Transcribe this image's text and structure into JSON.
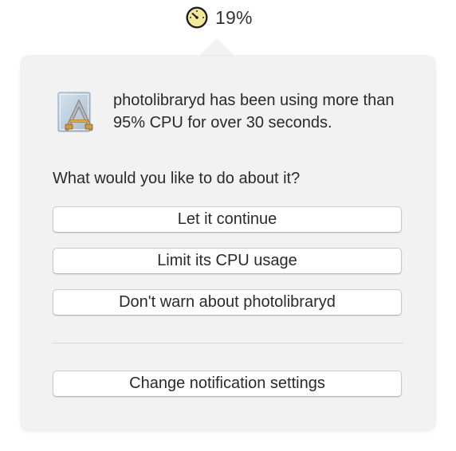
{
  "menubar": {
    "icon": "gauge-icon",
    "cpu_percent_text": "19%"
  },
  "alert": {
    "app_icon": "generic-application-icon",
    "message": "photolibraryd has been using more than 95% CPU for over 30 seconds.",
    "question": "What would you like to do about it?"
  },
  "actions": {
    "continue_label": "Let it continue",
    "limit_label": "Limit its CPU usage",
    "dont_warn_label": "Don't warn about photolibraryd",
    "settings_label": "Change notification settings"
  }
}
